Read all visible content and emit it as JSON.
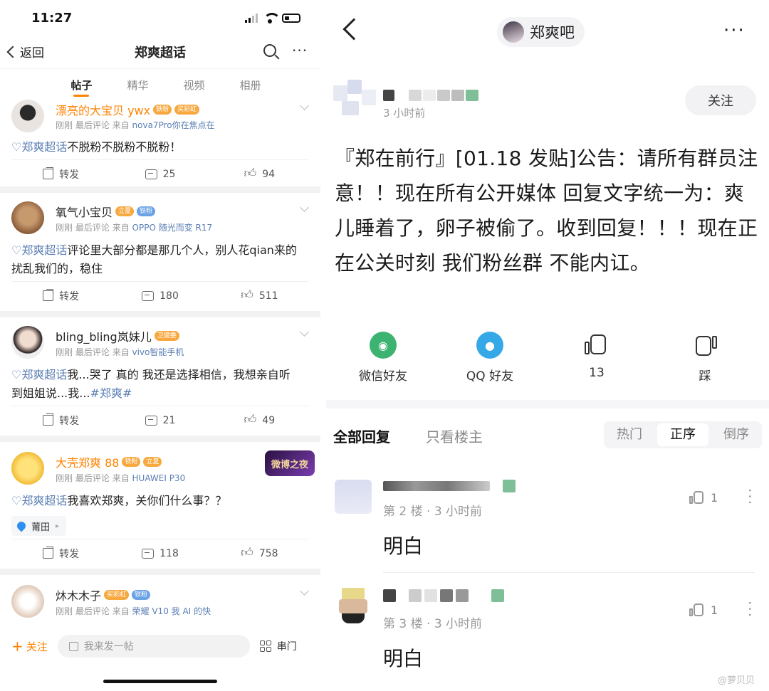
{
  "left": {
    "status_time": "11:27",
    "nav": {
      "back_label": "返回",
      "title": "郑爽超话"
    },
    "tabs": [
      "帖子",
      "精华",
      "视频",
      "相册"
    ],
    "posts": [
      {
        "username": "漂亮的大宝贝 ywx",
        "badges": [
          "铁粉",
          "买彩虹"
        ],
        "meta_time": "刚刚",
        "meta_action": "最后评论",
        "meta_from": "来自",
        "meta_source": "nova7Pro你在焦点在",
        "topic": "郑爽超话",
        "text": "不脱粉不脱粉不脱粉！",
        "forward": "转发",
        "comments": "25",
        "likes": "94"
      },
      {
        "username": "氧气小宝贝",
        "badges": [
          "立夏",
          "铁粉"
        ],
        "meta_time": "刚刚",
        "meta_action": "最后评论",
        "meta_from": "来自",
        "meta_source": "OPPO 随光而变 R17",
        "topic": "郑爽超话",
        "text": "评论里大部分都是那几个人，别人花qian来的扰乱我们的，稳住",
        "forward": "转发",
        "comments": "180",
        "likes": "511"
      },
      {
        "username": "bling_bling岚妹儿",
        "badges": [
          "卫健委"
        ],
        "meta_time": "刚刚",
        "meta_action": "最后评论",
        "meta_from": "来自",
        "meta_source": "vivo智能手机",
        "topic": "郑爽超话",
        "text": "我...哭了 真的 我还是选择相信，我想亲自听到姐姐说...我...",
        "hashtag": "#郑爽#",
        "forward": "转发",
        "comments": "21",
        "likes": "49"
      },
      {
        "username": "大壳郑爽 88",
        "badges": [
          "铁粉",
          "立夏"
        ],
        "meta_time": "刚刚",
        "meta_action": "最后评论",
        "meta_from": "来自",
        "meta_source": "HUAWEI P30",
        "topic": "郑爽超话",
        "text": "我喜欢郑爽，关你们什么事？？",
        "location": "莆田",
        "corner_badge": "微博之夜",
        "forward": "转发",
        "comments": "118",
        "likes": "758"
      },
      {
        "username": "炑木木子",
        "badges": [
          "买彩虹",
          "铁粉"
        ],
        "meta_time": "刚刚",
        "meta_action": "最后评论",
        "meta_from": "来自",
        "meta_source": "荣耀 V10 我 AI 的快"
      }
    ],
    "bottom": {
      "follow": "关注",
      "compose_placeholder": "我来发一帖",
      "chuanmen": "串门"
    }
  },
  "right": {
    "title": "郑爽吧",
    "op_time": "3 小时前",
    "follow": "关注",
    "content": "『郑在前行』[01.18 发贴]公告：请所有群员注意！！现在所有公开媒体 回复文字统一为：爽儿睡着了，卵子被偷了。收到回复！！！现在正在公关时刻 我们粉丝群 不能内讧。",
    "share": {
      "wechat": "微信好友",
      "qq": "QQ 好友",
      "like_count": "13",
      "dislike": "踩"
    },
    "reply_tabs": {
      "all": "全部回复",
      "op_only": "只看楼主"
    },
    "sort": [
      "热门",
      "正序",
      "倒序"
    ],
    "replies": [
      {
        "floor": "第 2 楼 · 3 小时前",
        "text": "明白",
        "likes": "1"
      },
      {
        "floor": "第 3 楼 · 3 小时前",
        "text": "明白",
        "likes": "1"
      }
    ],
    "watermark": "@萝贝贝"
  },
  "colors": {
    "weibo_orange": "#ff8200",
    "topic_blue": "#5b7fb4",
    "wechat_green": "#3cb371",
    "qq_blue": "#35a8e8"
  }
}
